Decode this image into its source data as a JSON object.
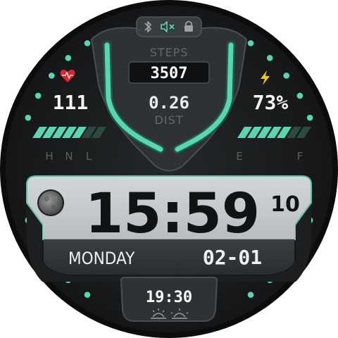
{
  "status_bar": {
    "bluetooth_icon": "bluetooth-icon",
    "mute_icon": "speaker-muted-icon",
    "lock_icon": "lock-icon"
  },
  "steps": {
    "label": "STEPS",
    "value": "3507"
  },
  "distance": {
    "value": "0.26",
    "label": "DIST"
  },
  "heart_rate": {
    "icon": "heart-pulse-icon",
    "value": "111",
    "bar_level": 0.7,
    "scale_labels": [
      "H",
      "N",
      "L"
    ]
  },
  "battery": {
    "icon": "lightning-bolt-icon",
    "value": "73%",
    "bar_level": 0.73,
    "scale_labels": [
      "E",
      "F"
    ]
  },
  "time": {
    "hours_minutes": "15:59",
    "seconds": "10",
    "moon_icon": "moon-phase-icon"
  },
  "date": {
    "weekday": "MONDAY",
    "day_month": "02-01"
  },
  "bottom": {
    "time": "19:30",
    "sunrise_icon": "sunrise-icon",
    "sunset_icon": "sunset-icon"
  },
  "colors": {
    "accent": "#59d6b0",
    "panel": "#c9ced0",
    "background": "#181a1b",
    "heart": "#e0242f",
    "bolt": "#f2c318"
  }
}
